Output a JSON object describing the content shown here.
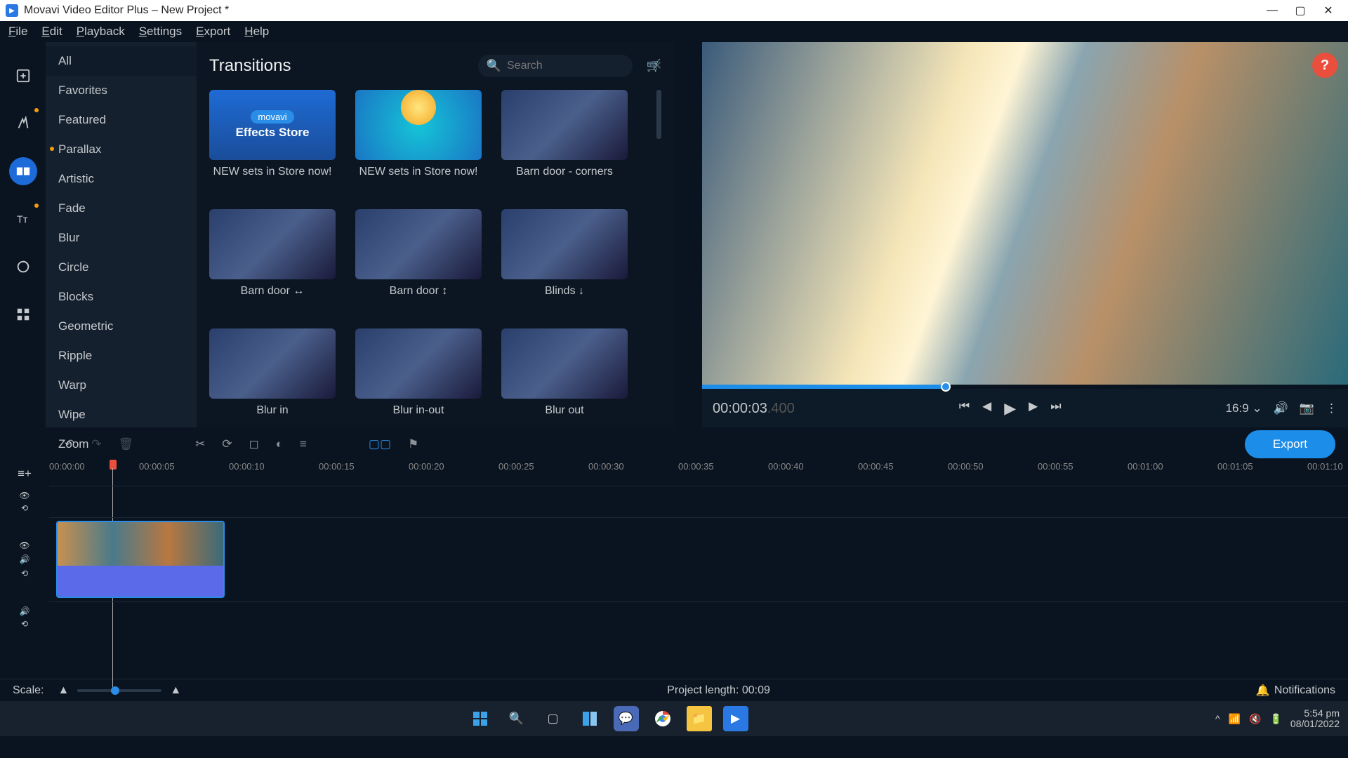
{
  "window": {
    "title": "Movavi Video Editor Plus – New Project *"
  },
  "menubar": [
    "File",
    "Edit",
    "Playback",
    "Settings",
    "Export",
    "Help"
  ],
  "categories": [
    {
      "label": "All",
      "active": true,
      "dot": false
    },
    {
      "label": "Favorites",
      "active": false,
      "dot": false
    },
    {
      "label": "Featured",
      "active": false,
      "dot": false
    },
    {
      "label": "Parallax",
      "active": false,
      "dot": true
    },
    {
      "label": "Artistic",
      "active": false,
      "dot": false
    },
    {
      "label": "Fade",
      "active": false,
      "dot": false
    },
    {
      "label": "Blur",
      "active": false,
      "dot": false
    },
    {
      "label": "Circle",
      "active": false,
      "dot": false
    },
    {
      "label": "Blocks",
      "active": false,
      "dot": false
    },
    {
      "label": "Geometric",
      "active": false,
      "dot": false
    },
    {
      "label": "Ripple",
      "active": false,
      "dot": false
    },
    {
      "label": "Warp",
      "active": false,
      "dot": false
    },
    {
      "label": "Wipe",
      "active": false,
      "dot": false
    },
    {
      "label": "Zoom",
      "active": false,
      "dot": false
    }
  ],
  "browser": {
    "title": "Transitions",
    "search_placeholder": "Search",
    "store_badge": "movavi",
    "store_text": "Effects Store",
    "items": [
      {
        "label": "NEW sets in Store now!",
        "kind": "store"
      },
      {
        "label": "NEW sets in Store now!",
        "kind": "store2"
      },
      {
        "label": "Barn door - corners",
        "kind": "fx"
      },
      {
        "label": "Barn door ↔",
        "kind": "fx"
      },
      {
        "label": "Barn door ↕",
        "kind": "fx"
      },
      {
        "label": "Blinds ↓",
        "kind": "fx"
      },
      {
        "label": "Blur in",
        "kind": "fx"
      },
      {
        "label": "Blur in-out",
        "kind": "fx"
      },
      {
        "label": "Blur out",
        "kind": "fx"
      }
    ]
  },
  "player": {
    "time_main": "00:00:03",
    "time_ms": ".400",
    "aspect": "16:9"
  },
  "export_label": "Export",
  "ruler_ticks": [
    "00:00:00",
    "00:00:05",
    "00:00:10",
    "00:00:15",
    "00:00:20",
    "00:00:25",
    "00:00:30",
    "00:00:35",
    "00:00:40",
    "00:00:45",
    "00:00:50",
    "00:00:55",
    "00:01:00",
    "00:01:05",
    "00:01:10"
  ],
  "footer": {
    "scale_label": "Scale:",
    "project_length": "Project length:  00:09",
    "notifications": "Notifications"
  },
  "taskbar": {
    "time": "5:54 pm",
    "date": "08/01/2022"
  }
}
